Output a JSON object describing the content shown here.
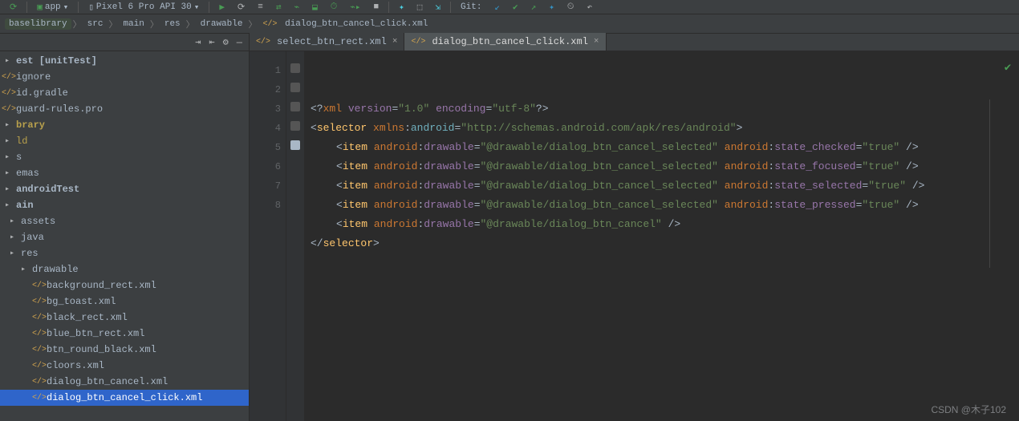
{
  "toolbar": {
    "run_config": "app",
    "device": "Pixel 6 Pro API 30",
    "git_label": "Git:"
  },
  "breadcrumbs": {
    "items": [
      "baselibrary",
      "src",
      "main",
      "res",
      "drawable"
    ],
    "file": "dialog_btn_cancel_click.xml"
  },
  "tree": {
    "items": [
      {
        "label": "est [unitTest]",
        "kind": "folder",
        "indent": 0,
        "bold": true
      },
      {
        "label": "ignore",
        "kind": "file",
        "indent": 0
      },
      {
        "label": "id.gradle",
        "kind": "file",
        "indent": 0
      },
      {
        "label": "guard-rules.pro",
        "kind": "file",
        "indent": 0
      },
      {
        "label": "brary",
        "kind": "folder",
        "indent": 0,
        "yellow": true,
        "bold": true
      },
      {
        "label": "ld",
        "kind": "folder",
        "indent": 0,
        "yellow": true
      },
      {
        "label": "s",
        "kind": "folder",
        "indent": 0
      },
      {
        "label": "emas",
        "kind": "folder",
        "indent": 0
      },
      {
        "label": "androidTest",
        "kind": "folder",
        "indent": 0,
        "bold": true
      },
      {
        "label": "ain",
        "kind": "folder",
        "indent": 0,
        "bold": true
      },
      {
        "label": "assets",
        "kind": "folder",
        "indent": 1
      },
      {
        "label": "java",
        "kind": "folder",
        "indent": 1
      },
      {
        "label": "res",
        "kind": "folder",
        "indent": 1
      },
      {
        "label": "drawable",
        "kind": "folder",
        "indent": 2
      },
      {
        "label": "background_rect.xml",
        "kind": "file",
        "indent": 3
      },
      {
        "label": "bg_toast.xml",
        "kind": "file",
        "indent": 3
      },
      {
        "label": "black_rect.xml",
        "kind": "file",
        "indent": 3
      },
      {
        "label": "blue_btn_rect.xml",
        "kind": "file",
        "indent": 3
      },
      {
        "label": "btn_round_black.xml",
        "kind": "file",
        "indent": 3
      },
      {
        "label": "cloors.xml",
        "kind": "file",
        "indent": 3
      },
      {
        "label": "dialog_btn_cancel.xml",
        "kind": "file",
        "indent": 3
      },
      {
        "label": "dialog_btn_cancel_click.xml",
        "kind": "file",
        "indent": 3,
        "selected": true
      }
    ]
  },
  "tabs": [
    {
      "label": "select_btn_rect.xml",
      "active": false
    },
    {
      "label": "dialog_btn_cancel_click.xml",
      "active": true
    }
  ],
  "code": {
    "xml_decl": {
      "version": "1.0",
      "encoding": "utf-8"
    },
    "root_tag": "selector",
    "xmlns_prefix": "xmlns",
    "ns_name": "android",
    "ns_uri": "http://schemas.android.com/apk/res/android",
    "item_tag": "item",
    "drawable_attr": "drawable",
    "sel_drawable": "@drawable/dialog_btn_cancel_selected",
    "def_drawable": "@drawable/dialog_btn_cancel",
    "states": [
      "state_checked",
      "state_focused",
      "state_selected",
      "state_pressed"
    ],
    "true_val": "true",
    "caret_line": 7
  },
  "watermark": "CSDN @木子102"
}
